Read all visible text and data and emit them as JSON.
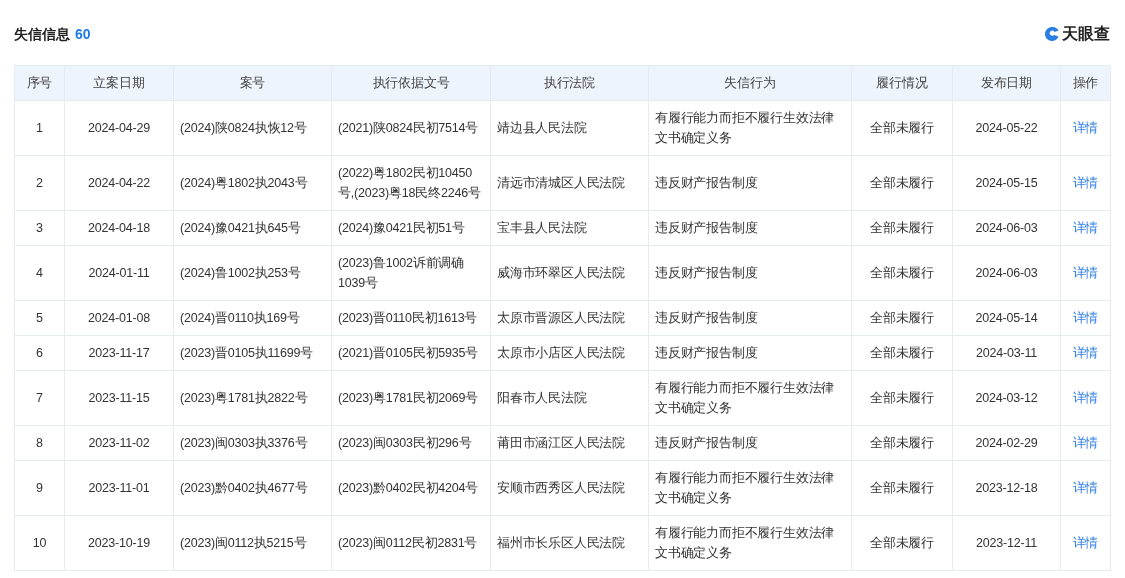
{
  "title": "失信信息",
  "count": "60",
  "logo": {
    "text": "天眼查"
  },
  "table": {
    "columns": [
      "序号",
      "立案日期",
      "案号",
      "执行依据文号",
      "执行法院",
      "失信行为",
      "履行情况",
      "发布日期",
      "操作"
    ],
    "rows": [
      [
        "1",
        "2024-04-29",
        "(2024)陕0824执恢12号",
        "(2021)陕0824民初7514号",
        "靖边县人民法院",
        "有履行能力而拒不履行生效法律文书确定义务",
        "全部未履行",
        "2024-05-22",
        "详情"
      ],
      [
        "2",
        "2024-04-22",
        "(2024)粤1802执2043号",
        "(2022)粤1802民初10450号,(2023)粤18民终2246号",
        "清远市清城区人民法院",
        "违反财产报告制度",
        "全部未履行",
        "2024-05-15",
        "详情"
      ],
      [
        "3",
        "2024-04-18",
        "(2024)豫0421执645号",
        "(2024)豫0421民初51号",
        "宝丰县人民法院",
        "违反财产报告制度",
        "全部未履行",
        "2024-06-03",
        "详情"
      ],
      [
        "4",
        "2024-01-11",
        "(2024)鲁1002执253号",
        "(2023)鲁1002诉前调确1039号",
        "威海市环翠区人民法院",
        "违反财产报告制度",
        "全部未履行",
        "2024-06-03",
        "详情"
      ],
      [
        "5",
        "2024-01-08",
        "(2024)晋0110执169号",
        "(2023)晋0110民初1613号",
        "太原市晋源区人民法院",
        "违反财产报告制度",
        "全部未履行",
        "2024-05-14",
        "详情"
      ],
      [
        "6",
        "2023-11-17",
        "(2023)晋0105执11699号",
        "(2021)晋0105民初5935号",
        "太原市小店区人民法院",
        "违反财产报告制度",
        "全部未履行",
        "2024-03-11",
        "详情"
      ],
      [
        "7",
        "2023-11-15",
        "(2023)粤1781执2822号",
        "(2023)粤1781民初2069号",
        "阳春市人民法院",
        "有履行能力而拒不履行生效法律文书确定义务",
        "全部未履行",
        "2024-03-12",
        "详情"
      ],
      [
        "8",
        "2023-11-02",
        "(2023)闽0303执3376号",
        "(2023)闽0303民初296号",
        "莆田市涵江区人民法院",
        "违反财产报告制度",
        "全部未履行",
        "2024-02-29",
        "详情"
      ],
      [
        "9",
        "2023-11-01",
        "(2023)黔0402执4677号",
        "(2023)黔0402民初4204号",
        "安顺市西秀区人民法院",
        "有履行能力而拒不履行生效法律文书确定义务",
        "全部未履行",
        "2023-12-18",
        "详情"
      ],
      [
        "10",
        "2023-10-19",
        "(2023)闽0112执5215号",
        "(2023)闽0112民初2831号",
        "福州市长乐区人民法院",
        "有履行能力而拒不履行生效法律文书确定义务",
        "全部未履行",
        "2023-12-11",
        "详情"
      ]
    ]
  }
}
